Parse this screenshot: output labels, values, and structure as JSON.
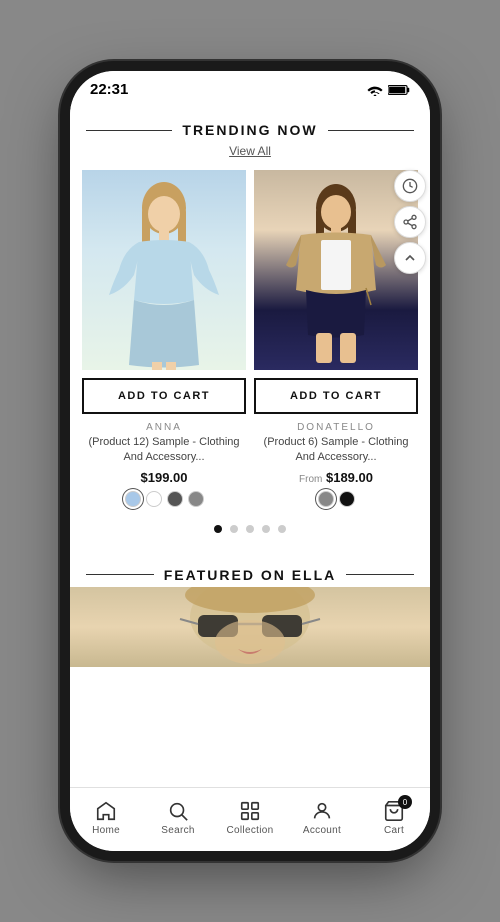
{
  "statusBar": {
    "time": "22:31"
  },
  "trending": {
    "sectionTitle": "TRENDING NOW",
    "viewAllLabel": "View All",
    "products": [
      {
        "id": "product-1",
        "brand": "ANNA",
        "name": "(Product 12) Sample - Clothing And Accessory...",
        "price": "$199.00",
        "fromLabel": "",
        "addToCartLabel": "ADD TO CART",
        "colors": [
          "#a8c8e8",
          "#ffffff",
          "#555555",
          "#888888"
        ],
        "selectedColor": 0
      },
      {
        "id": "product-2",
        "brand": "DONATELLO",
        "name": "(Product 6) Sample - Clothing And Accessory...",
        "price": "$189.00",
        "fromLabel": "From",
        "addToCartLabel": "ADD TO CART",
        "colors": [
          "#888888",
          "#111111"
        ],
        "selectedColor": 0
      }
    ],
    "paginationDots": 5,
    "activeDot": 0
  },
  "featured": {
    "sectionTitle": "FEATURED ON ELLA"
  },
  "bottomNav": {
    "items": [
      {
        "id": "home",
        "label": "Home",
        "icon": "home-icon"
      },
      {
        "id": "search",
        "label": "Search",
        "icon": "search-icon"
      },
      {
        "id": "collection",
        "label": "Collection",
        "icon": "collection-icon"
      },
      {
        "id": "account",
        "label": "Account",
        "icon": "account-icon"
      },
      {
        "id": "cart",
        "label": "Cart",
        "icon": "cart-icon",
        "badge": "0"
      }
    ]
  }
}
